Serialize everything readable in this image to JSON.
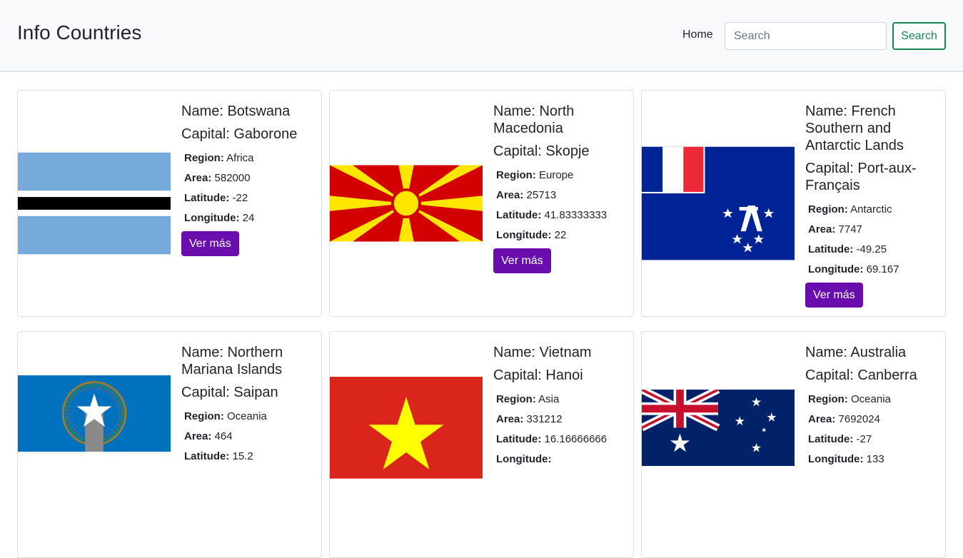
{
  "header": {
    "title": "Info Countries",
    "nav_home": "Home",
    "search_placeholder": "Search",
    "search_button": "Search"
  },
  "labels": {
    "name_prefix": "Name: ",
    "capital_prefix": "Capital: ",
    "region": "Region:",
    "area": "Area:",
    "latitude": "Latitude:",
    "longitude": "Longitude:",
    "button": "Ver más"
  },
  "countries": [
    {
      "name": "Botswana",
      "capital": "Gaborone",
      "region": "Africa",
      "area": "582000",
      "latitude": "-22",
      "longitude": "24",
      "flag": "botswana-flag"
    },
    {
      "name": "North Macedonia",
      "capital": "Skopje",
      "region": "Europe",
      "area": "25713",
      "latitude": "41.83333333",
      "longitude": "22",
      "flag": "north-macedonia-flag"
    },
    {
      "name": "French Southern and Antarctic Lands",
      "capital": "Port-aux-Français",
      "region": "Antarctic",
      "area": "7747",
      "latitude": "-49.25",
      "longitude": "69.167",
      "flag": "taaf-flag"
    },
    {
      "name": "Northern Mariana Islands",
      "capital": "Saipan",
      "region": "Oceania",
      "area": "464",
      "latitude": "15.2",
      "longitude": "",
      "flag": "northern-mariana-flag"
    },
    {
      "name": "Vietnam",
      "capital": "Hanoi",
      "region": "Asia",
      "area": "331212",
      "latitude": "16.16666666",
      "longitude": "",
      "flag": "vietnam-flag"
    },
    {
      "name": "Australia",
      "capital": "Canberra",
      "region": "Oceania",
      "area": "7692024",
      "latitude": "-27",
      "longitude": "133",
      "flag": "australia-flag"
    }
  ],
  "colors": {
    "accent_button": "#6a0dad",
    "search_outline": "#198754",
    "navbar_bg": "#f8f9fa"
  }
}
